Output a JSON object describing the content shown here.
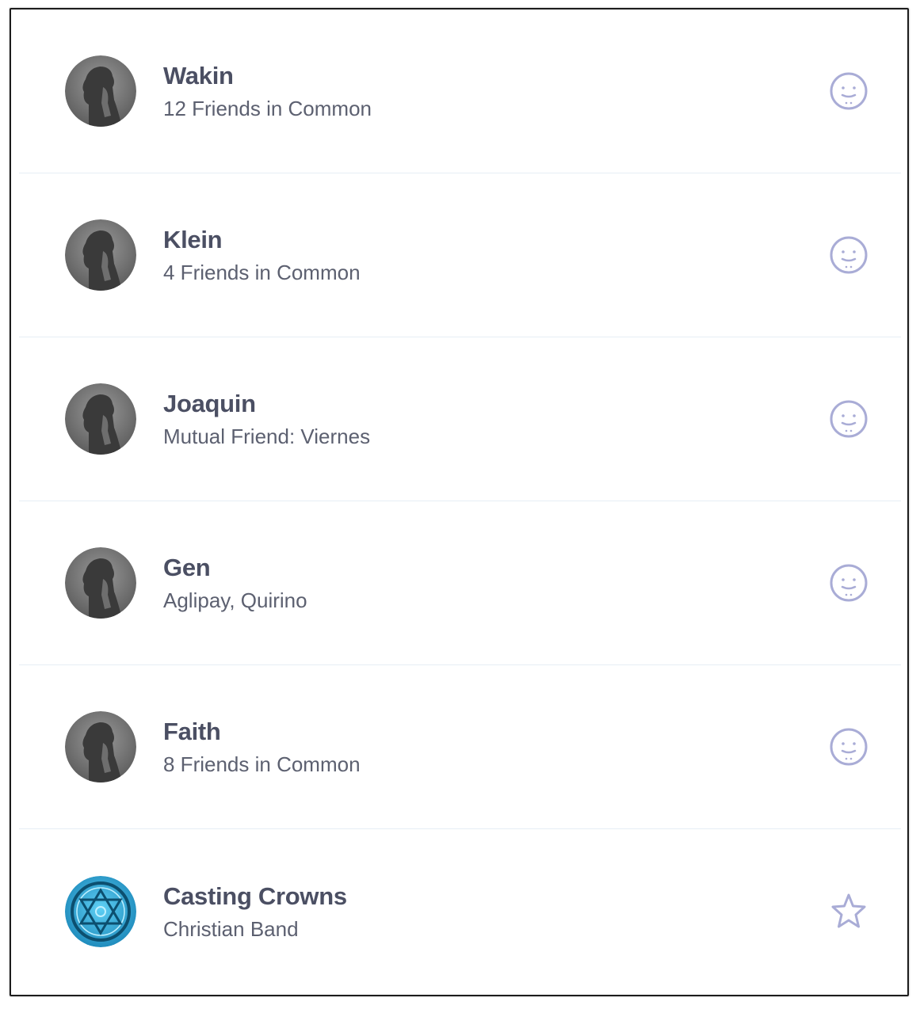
{
  "people": [
    {
      "name": "Wakin",
      "subtitle": "12 Friends in Common",
      "avatar_icon": "default-silhouette-avatar",
      "action_icon": "smiley-face-icon"
    },
    {
      "name": "Klein",
      "subtitle": "4 Friends in Common",
      "avatar_icon": "default-silhouette-avatar",
      "action_icon": "smiley-face-icon"
    },
    {
      "name": "Joaquin",
      "subtitle": "Mutual Friend: Viernes",
      "avatar_icon": "default-silhouette-avatar",
      "action_icon": "smiley-face-icon"
    },
    {
      "name": "Gen",
      "subtitle": "Aglipay, Quirino",
      "avatar_icon": "default-silhouette-avatar",
      "action_icon": "smiley-face-icon"
    },
    {
      "name": "Faith",
      "subtitle": "8 Friends in Common",
      "avatar_icon": "default-silhouette-avatar",
      "action_icon": "smiley-face-icon"
    },
    {
      "name": "Casting Crowns",
      "subtitle": "Christian Band",
      "avatar_icon": "band-logo-avatar",
      "action_icon": "star-icon"
    }
  ],
  "colors": {
    "name_text": "#4b4f63",
    "sub_text": "#5c6070",
    "icon_stroke": "#a9acd6",
    "divider": "#e6eef5",
    "band_logo": "#2aa7d8"
  }
}
